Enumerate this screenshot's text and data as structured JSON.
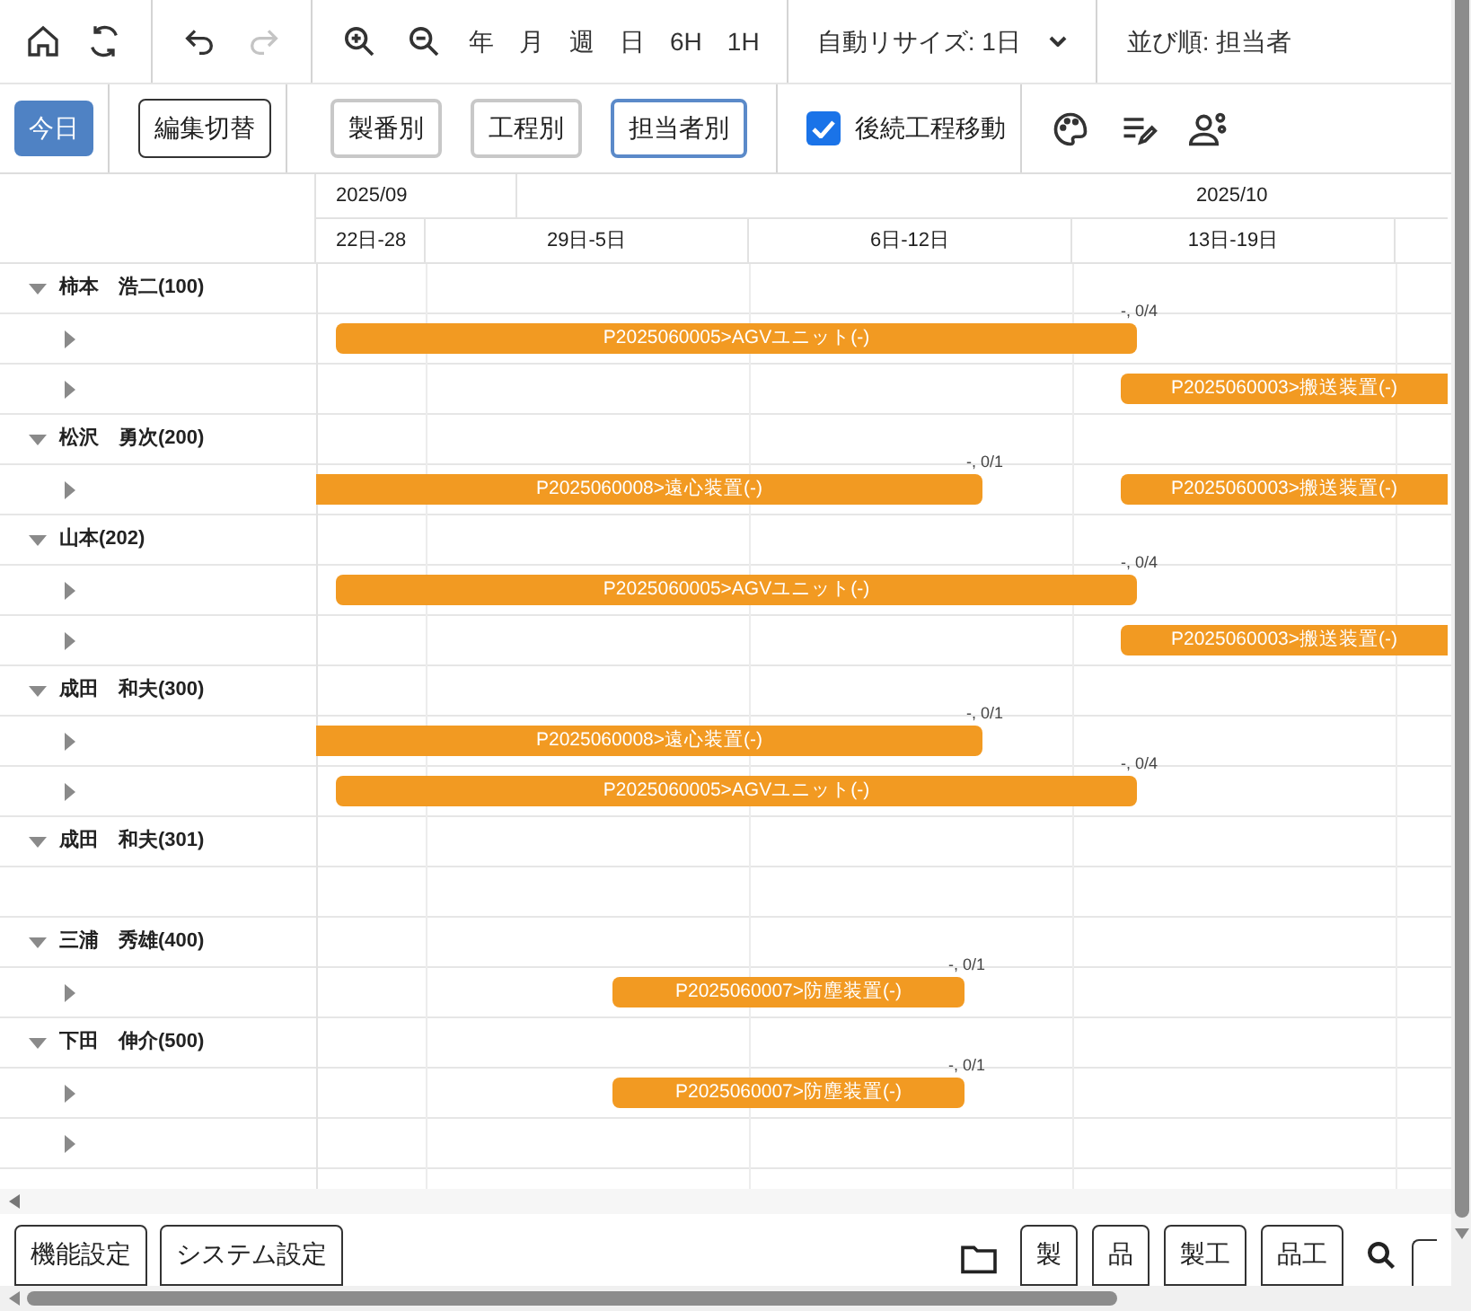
{
  "toolbar": {
    "scales": [
      "年",
      "月",
      "週",
      "日",
      "6H",
      "1H"
    ],
    "redo_disabled": true,
    "auto_resize": "自動リサイズ: 1日",
    "sort": "並び順: 担当者"
  },
  "actions": {
    "today": "今日",
    "edit_toggle": "編集切替",
    "views": [
      {
        "label": "製番別",
        "selected": false
      },
      {
        "label": "工程別",
        "selected": false
      },
      {
        "label": "担当者別",
        "selected": true
      }
    ],
    "follow_move": {
      "label": "後続工程移動",
      "checked": true
    }
  },
  "timeline": {
    "months": [
      "2025/09",
      "2025/10"
    ],
    "weeks": [
      "22日-28",
      "29日-5日",
      "6日-12日",
      "13日-19日"
    ]
  },
  "groups": [
    {
      "name": "柿本　浩二(100)",
      "expanded": true,
      "children": [
        {
          "expandable": true,
          "bars": [
            {
              "label": "P2025060005>AGVユニット(-)",
              "kind": "wide",
              "progress": "-, 0/4"
            }
          ]
        },
        {
          "expandable": true,
          "bars": [
            {
              "label": "P2025060003>搬送装置(-)",
              "kind": "tail"
            }
          ]
        }
      ]
    },
    {
      "name": "松沢　勇次(200)",
      "expanded": true,
      "children": [
        {
          "expandable": true,
          "bars": [
            {
              "label": "P2025060008>遠心装置(-)",
              "kind": "head",
              "progress": "-, 0/1"
            },
            {
              "label": "P2025060003>搬送装置(-)",
              "kind": "tail"
            }
          ]
        }
      ]
    },
    {
      "name": "山本(202)",
      "expanded": true,
      "children": [
        {
          "expandable": true,
          "bars": [
            {
              "label": "P2025060005>AGVユニット(-)",
              "kind": "wide",
              "progress": "-, 0/4"
            }
          ]
        },
        {
          "expandable": true,
          "bars": [
            {
              "label": "P2025060003>搬送装置(-)",
              "kind": "tail"
            }
          ]
        }
      ]
    },
    {
      "name": "成田　和夫(300)",
      "expanded": true,
      "children": [
        {
          "expandable": true,
          "bars": [
            {
              "label": "P2025060008>遠心装置(-)",
              "kind": "head",
              "progress": "-, 0/1"
            }
          ]
        },
        {
          "expandable": true,
          "bars": [
            {
              "label": "P2025060005>AGVユニット(-)",
              "kind": "wide",
              "progress": "-, 0/4"
            }
          ]
        }
      ]
    },
    {
      "name": "成田　和夫(301)",
      "expanded": true,
      "children": [
        {
          "expandable": false
        }
      ]
    },
    {
      "name": "三浦　秀雄(400)",
      "expanded": true,
      "children": [
        {
          "expandable": true,
          "bars": [
            {
              "label": "P2025060007>防塵装置(-)",
              "kind": "middle",
              "progress": "-, 0/1"
            }
          ]
        }
      ]
    },
    {
      "name": "下田　伸介(500)",
      "expanded": true,
      "children": [
        {
          "expandable": true,
          "bars": [
            {
              "label": "P2025060007>防塵装置(-)",
              "kind": "middle",
              "progress": "-, 0/1"
            }
          ]
        },
        {
          "expandable": true
        }
      ]
    }
  ],
  "footer": {
    "left": [
      "機能設定",
      "システム設定"
    ],
    "right": [
      "製",
      "品",
      "製工",
      "品工"
    ]
  }
}
